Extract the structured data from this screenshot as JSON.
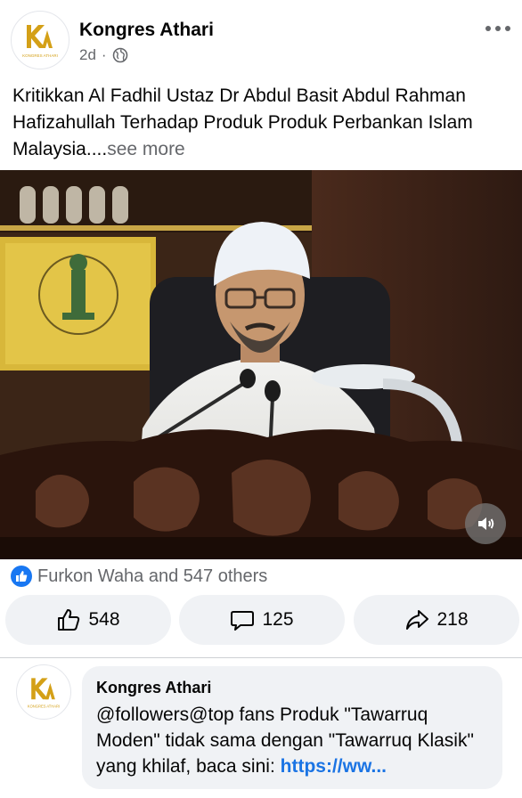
{
  "post": {
    "page_name": "Kongres Athari",
    "time": "2d",
    "separator": "·",
    "privacy_icon": "globe-icon",
    "more_icon": "more-horizontal-icon",
    "text": "Kritikkan Al Fadhil Ustaz Dr Abdul Basit Abdul Rahman Hafizahullah Terhadap Produk Produk Perbankan Islam Malaysia....",
    "see_more": "see more"
  },
  "logo": {
    "caption": "KONGRES ATHARI",
    "color": "#d4a017"
  },
  "video": {
    "mute_icon": "speaker-icon"
  },
  "reactions": {
    "icon": "like-badge-icon",
    "summary": "Furkon Waha and 547 others"
  },
  "actions": {
    "like_count": "548",
    "comment_count": "125",
    "share_count": "218"
  },
  "comment": {
    "author": "Kongres Athari",
    "text": "@followers@top fans Produk \"Tawarruq Moden\" tidak sama dengan \"Tawarruq Klasik\" yang khilaf, baca sini: ",
    "link": "https://ww..."
  },
  "colors": {
    "accent": "#1877f2",
    "link": "#1b74e4",
    "secondary_text": "#65676b",
    "button_bg": "#f0f2f5"
  }
}
